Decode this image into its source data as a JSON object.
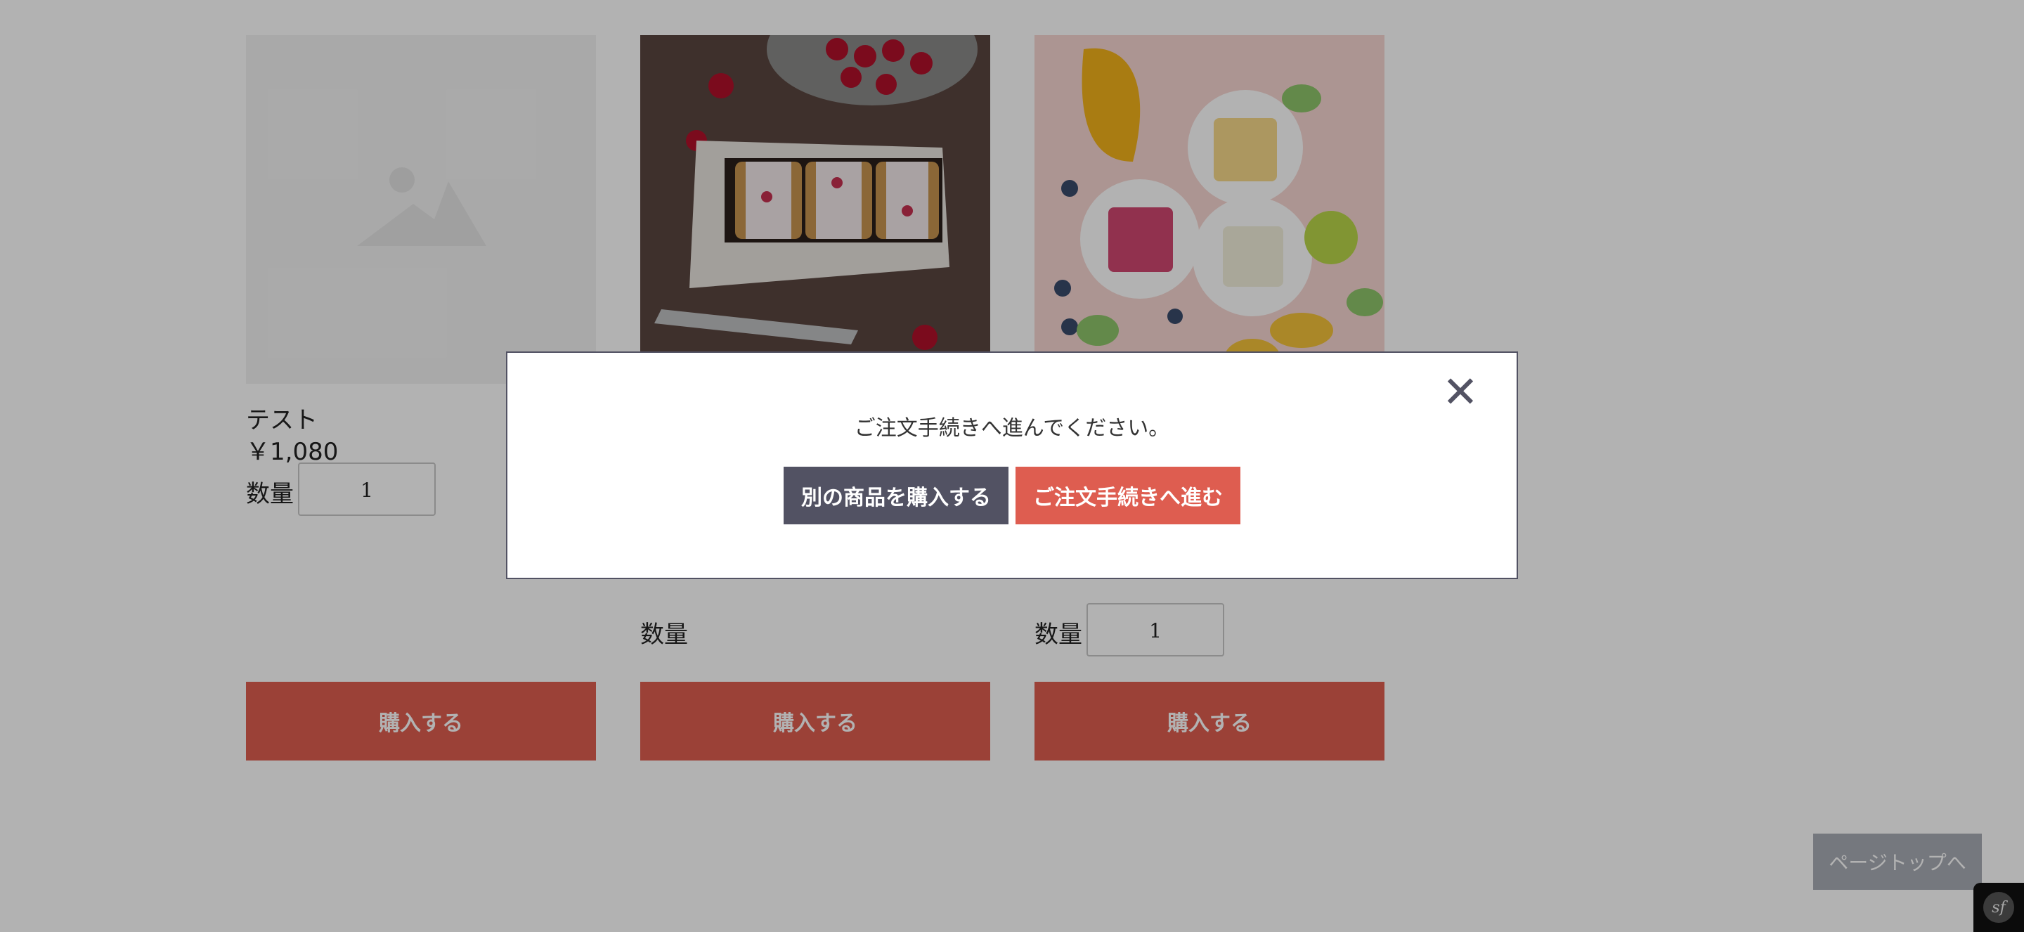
{
  "products": [
    {
      "name": "テスト",
      "price": "￥1,080",
      "qty_label": "数量",
      "qty_value": "1",
      "buy_label": "購入する",
      "image": "image-placeholder-icon"
    },
    {
      "qty_label": "数量",
      "buy_label": "購入する",
      "image": "cherry-ice-sandwich-photo"
    },
    {
      "qty_label": "数量",
      "qty_value": "1",
      "buy_label": "購入する",
      "image": "sorbet-bowls-photo"
    }
  ],
  "modal": {
    "message": "ご注文手続きへ進んでください。",
    "continue_shopping_label": "別の商品を購入する",
    "checkout_label": "ご注文手続きへ進む",
    "close_icon": "close-icon"
  },
  "page_top_label": "ページトップへ",
  "debug_toolbar_logo": "sf",
  "colors": {
    "accent": "#de5d50",
    "secondary": "#525263",
    "overlay": "rgba(0,0,0,0.3)"
  }
}
